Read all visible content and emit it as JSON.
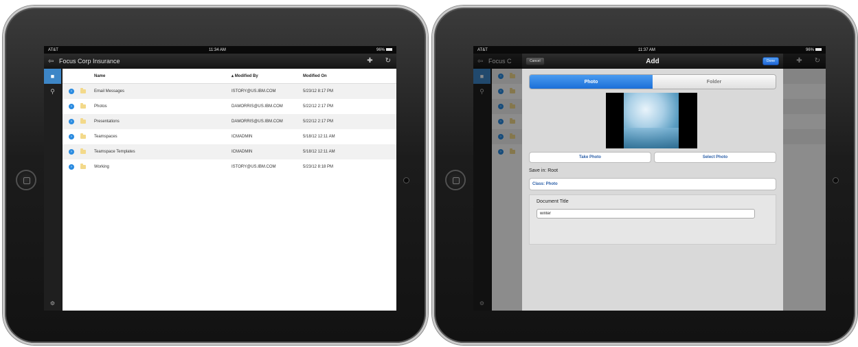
{
  "left_screen": {
    "status": {
      "carrier": "AT&T",
      "time": "11:34 AM",
      "battery": "96%"
    },
    "title": "Focus Corp Insurance",
    "toolbar_icons": [
      "back-arrow-icon",
      "plus-icon",
      "refresh-icon"
    ],
    "sidebar_icons": [
      "folder-icon",
      "search-icon",
      "settings-icon"
    ],
    "columns": {
      "name": "Name",
      "modified_by": "Modified By",
      "modified_on": "Modified On"
    },
    "rows": [
      {
        "name": "Email Messages",
        "modified_by": "ISTORY@US.IBM.COM",
        "modified_on": "5/23/12 8:17 PM"
      },
      {
        "name": "Photos",
        "modified_by": "DAMORRIS@US.IBM.COM",
        "modified_on": "5/22/12 2:17 PM"
      },
      {
        "name": "Presentations",
        "modified_by": "DAMORRIS@US.IBM.COM",
        "modified_on": "5/22/12 2:17 PM"
      },
      {
        "name": "Teamspaces",
        "modified_by": "ICMADMIN",
        "modified_on": "5/18/12 12:11 AM"
      },
      {
        "name": "Teamspace Templates",
        "modified_by": "ICMADMIN",
        "modified_on": "5/18/12 12:11 AM"
      },
      {
        "name": "Working",
        "modified_by": "ISTORY@US.IBM.COM",
        "modified_on": "5/23/12 8:18 PM"
      }
    ]
  },
  "right_screen": {
    "status": {
      "carrier": "AT&T",
      "time": "11:37 AM",
      "battery": "96%"
    },
    "background_title": "Focus C",
    "modal": {
      "title": "Add",
      "cancel_label": "Cancel",
      "done_label": "Done",
      "segments": [
        "Photo",
        "Folder"
      ],
      "selected_segment": "Photo",
      "take_photo_label": "Take Photo",
      "select_photo_label": "Select Photo",
      "save_in_label": "Save in:",
      "save_in_value": "Root",
      "class_label": "Class: Photo",
      "document_title_label": "Document Title",
      "document_title_value": "winter"
    }
  }
}
